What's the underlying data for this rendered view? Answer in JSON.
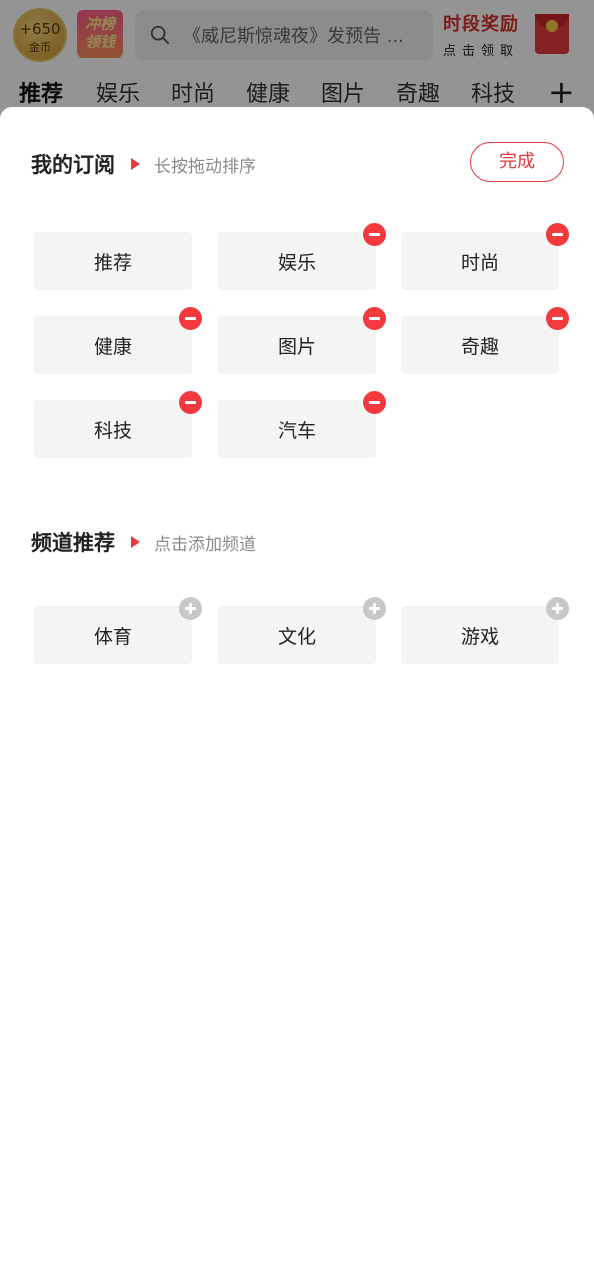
{
  "header": {
    "coin_amount": "+650",
    "coin_unit": "金币",
    "rank_badge_line1": "冲榜",
    "rank_badge_line2": "领钱",
    "search_placeholder": "《威尼斯惊魂夜》发预告 ...",
    "reward_title": "时段奖励",
    "reward_subtitle": "点击领取"
  },
  "tabs": [
    "推荐",
    "娱乐",
    "时尚",
    "健康",
    "图片",
    "奇趣",
    "科技"
  ],
  "tab_active_index": 0,
  "tab_add_label": "+",
  "panel": {
    "subscribed": {
      "title": "我的订阅",
      "hint": "长按拖动排序",
      "done_label": "完成",
      "channels": [
        {
          "label": "推荐",
          "removable": false
        },
        {
          "label": "娱乐",
          "removable": true
        },
        {
          "label": "时尚",
          "removable": true
        },
        {
          "label": "健康",
          "removable": true
        },
        {
          "label": "图片",
          "removable": true
        },
        {
          "label": "奇趣",
          "removable": true
        },
        {
          "label": "科技",
          "removable": true
        },
        {
          "label": "汽车",
          "removable": true
        }
      ]
    },
    "recommended": {
      "title": "频道推荐",
      "hint": "点击添加频道",
      "channels": [
        {
          "label": "体育"
        },
        {
          "label": "文化"
        },
        {
          "label": "游戏"
        }
      ]
    }
  },
  "colors": {
    "accent": "#e6393f",
    "chip_bg": "#f4f4f4",
    "add_mark": "#c8c8c8"
  }
}
